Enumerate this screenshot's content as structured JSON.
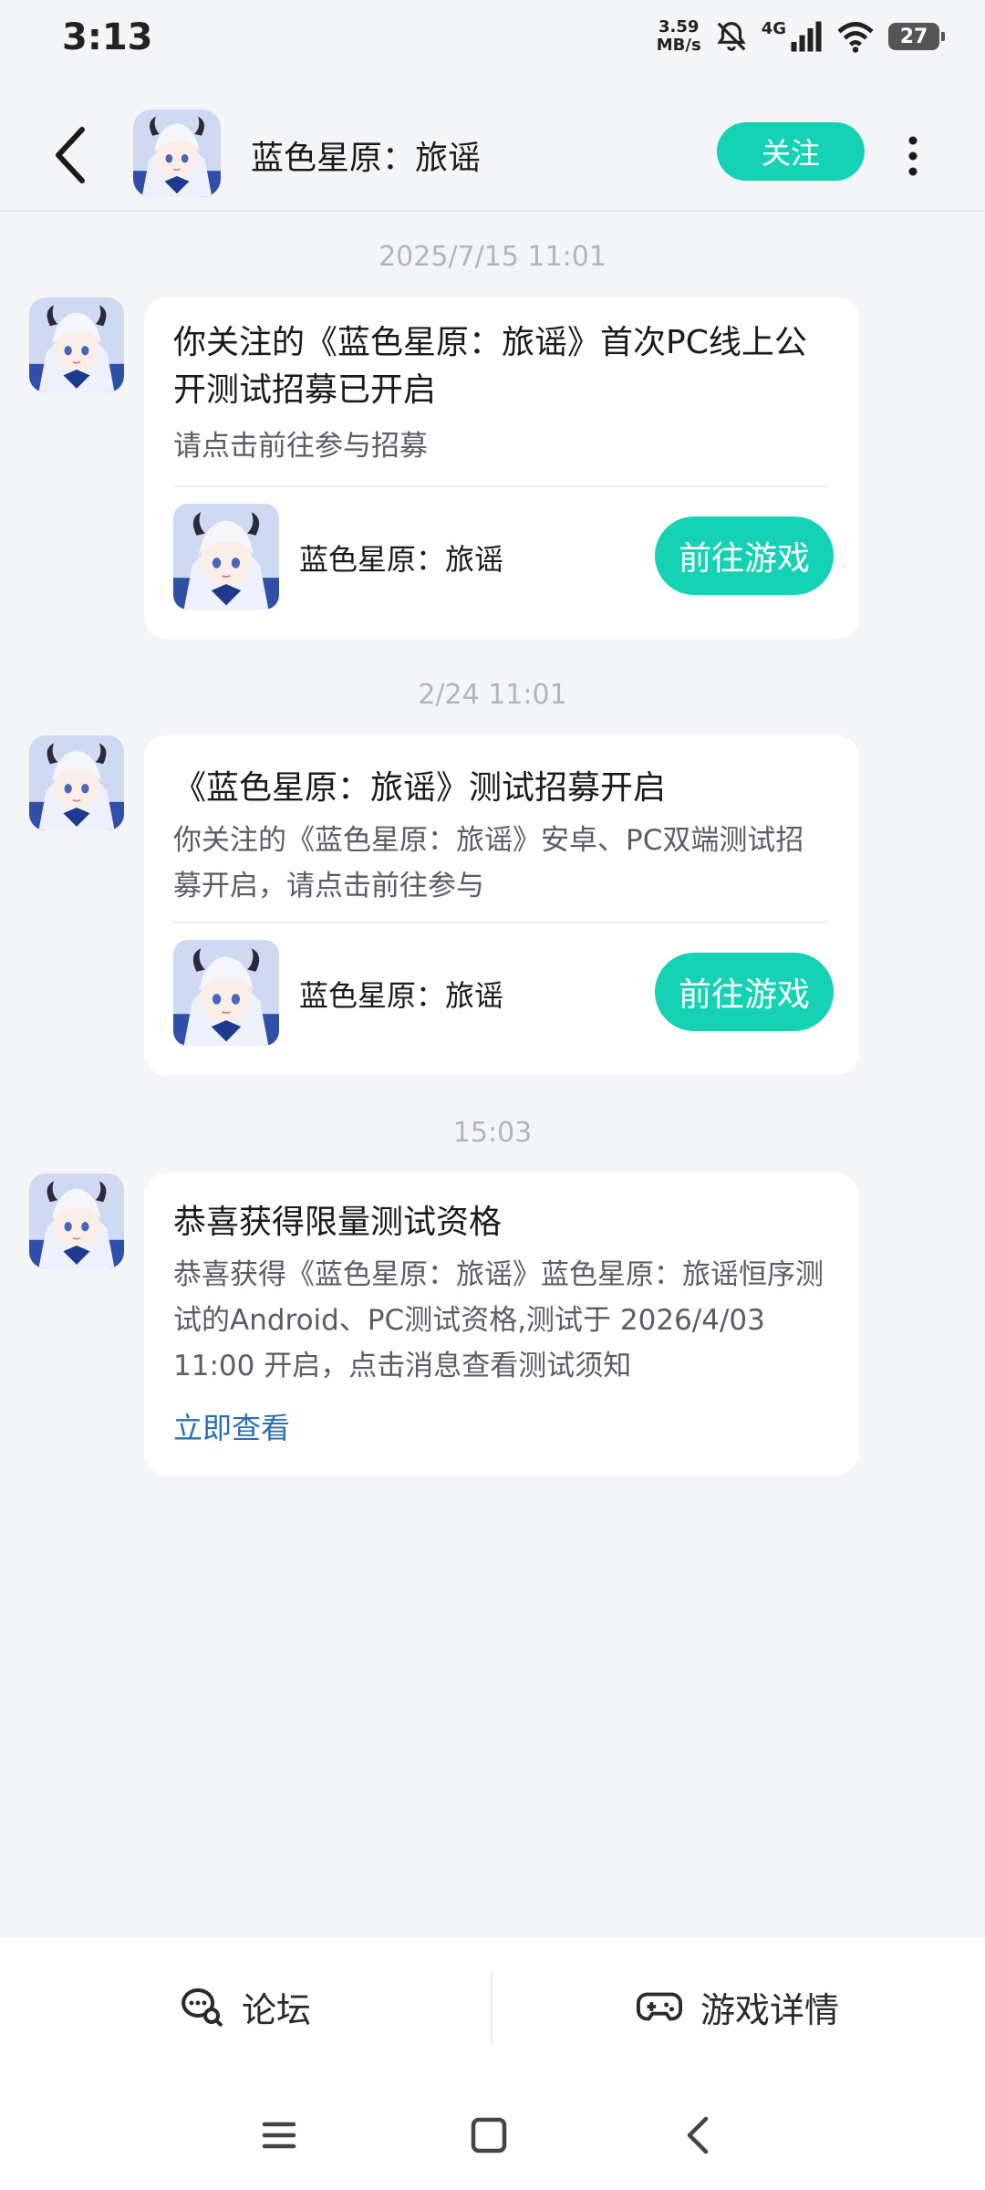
{
  "status_bar": {
    "time": "3:13",
    "speed_value": "3.59",
    "speed_unit": "MB/s",
    "network": "4G",
    "battery": "27"
  },
  "header": {
    "title": "蓝色星原：旅谣",
    "follow_label": "关注"
  },
  "messages": [
    {
      "timestamp": "2025/7/15  11:01",
      "title": "你关注的《蓝色星原：旅谣》首次PC线上公开测试招募已开启",
      "body": "请点击前往参与招募",
      "game_name": "蓝色星原：旅谣",
      "action_label": "前往游戏"
    },
    {
      "timestamp": "2/24  11:01",
      "title": "《蓝色星原：旅谣》测试招募开启",
      "body": "你关注的《蓝色星原：旅谣》安卓、PC双端测试招募开启，请点击前往参与",
      "game_name": "蓝色星原：旅谣",
      "action_label": "前往游戏"
    },
    {
      "timestamp": "15:03",
      "title": "恭喜获得限量测试资格",
      "body": "恭喜获得《蓝色星原：旅谣》蓝色星原：旅谣恒序测试的Android、PC测试资格,测试于 2026/4/03 11:00 开启，点击消息查看测试须知",
      "link_label": "立即查看"
    }
  ],
  "tabs": {
    "forum_label": "论坛",
    "details_label": "游戏详情"
  },
  "colors": {
    "accent": "#16d2b4",
    "link": "#2a6fb0",
    "background": "#f4f5f7"
  }
}
